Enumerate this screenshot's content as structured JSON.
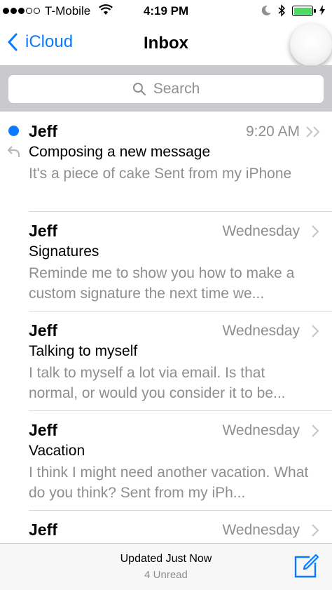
{
  "status_bar": {
    "carrier": "T-Mobile",
    "time": "4:19 PM",
    "signal_bars_filled": 3,
    "signal_bars_total": 5,
    "battery_level": 1.0,
    "battery_color": "#4cd964"
  },
  "nav": {
    "back_label": "iCloud",
    "title": "Inbox",
    "accent_color": "#0a7aff"
  },
  "search": {
    "placeholder": "Search"
  },
  "messages": [
    {
      "sender": "Jeff",
      "time": "9:20 AM",
      "subject": "Composing a new message",
      "preview": "It's a piece of cake Sent from my iPhone",
      "unread": true,
      "replied": true
    },
    {
      "sender": "Jeff",
      "time": "Wednesday",
      "subject": "Signatures",
      "preview": "Reminde me to show you how to make a custom signature the next time we...",
      "unread": false,
      "replied": false
    },
    {
      "sender": "Jeff",
      "time": "Wednesday",
      "subject": "Talking to myself",
      "preview": "I talk to myself a lot via email. Is that normal, or would you consider it to be...",
      "unread": false,
      "replied": false
    },
    {
      "sender": "Jeff",
      "time": "Wednesday",
      "subject": "Vacation",
      "preview": "I think I might need another vacation. What do you think? Sent from my iPh...",
      "unread": false,
      "replied": false
    },
    {
      "sender": "Jeff",
      "time": "Wednesday",
      "subject": "",
      "preview": "",
      "unread": false,
      "replied": false
    }
  ],
  "toolbar": {
    "status": "Updated Just Now",
    "unread_count": "4 Unread"
  }
}
